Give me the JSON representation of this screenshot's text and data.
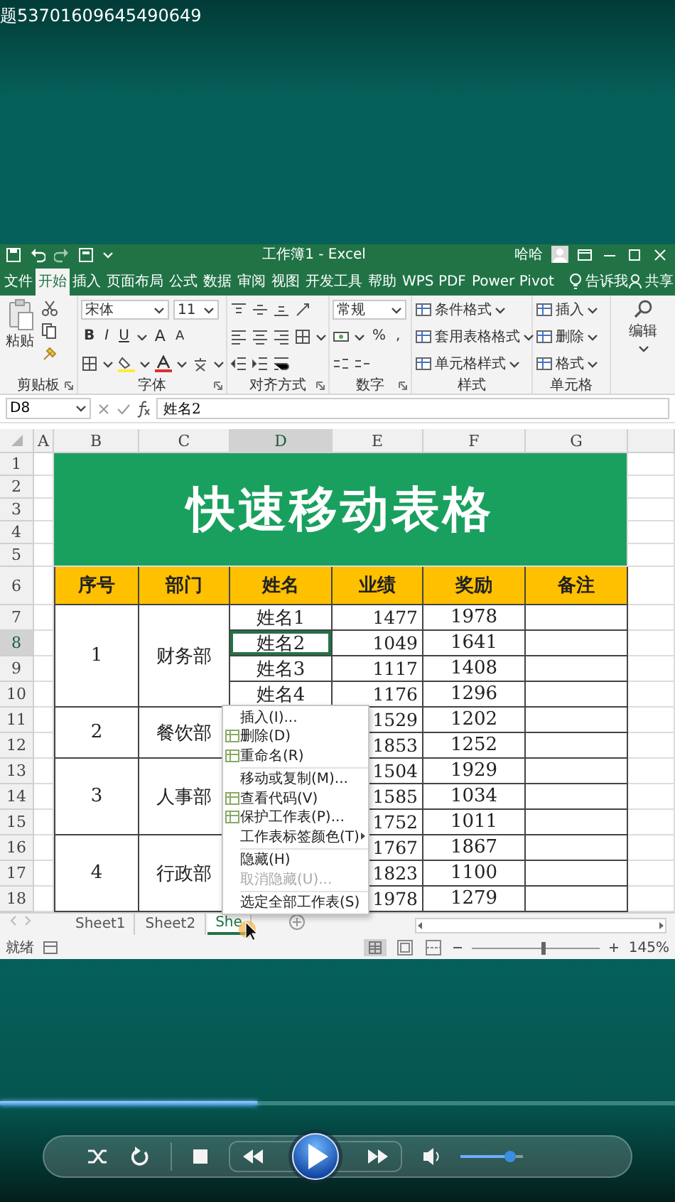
{
  "video_title": "题53701609645490649",
  "excel": {
    "window_title": "工作簿1 - Excel",
    "user": "哈哈",
    "ribbon_tabs": [
      {
        "label": "文件",
        "selected": false
      },
      {
        "label": "开始",
        "selected": true
      },
      {
        "label": "插入",
        "selected": false
      },
      {
        "label": "页面布局",
        "selected": false
      },
      {
        "label": "公式",
        "selected": false
      },
      {
        "label": "数据",
        "selected": false
      },
      {
        "label": "审阅",
        "selected": false
      },
      {
        "label": "视图",
        "selected": false
      },
      {
        "label": "开发工具",
        "selected": false
      },
      {
        "label": "帮助",
        "selected": false
      },
      {
        "label": "WPS PDF",
        "selected": false
      },
      {
        "label": "Power Pivot",
        "selected": false
      }
    ],
    "tell_me": "告诉我",
    "share": "共享",
    "ribbon": {
      "paste": "粘贴",
      "font_name": "宋体",
      "font_size": "11",
      "bold": "B",
      "italic": "I",
      "underline": "U",
      "grow_font": "A",
      "shrink_font": "A",
      "number_format": "常规",
      "percent": "%",
      "comma": ",",
      "styles": [
        "条件格式",
        "套用表格格式",
        "单元格样式"
      ],
      "cells": [
        "插入",
        "删除",
        "格式"
      ],
      "editing": "编辑",
      "groups": [
        "剪贴板",
        "字体",
        "对齐方式",
        "数字",
        "样式",
        "单元格"
      ]
    },
    "name_box": "D8",
    "formula": "姓名2",
    "columns": [
      {
        "label": "A",
        "selected": false
      },
      {
        "label": "B",
        "selected": false
      },
      {
        "label": "C",
        "selected": false
      },
      {
        "label": "D",
        "selected": true
      },
      {
        "label": "E",
        "selected": false
      },
      {
        "label": "F",
        "selected": false
      },
      {
        "label": "G",
        "selected": false
      }
    ],
    "rows": [
      {
        "label": "1",
        "selected": false
      },
      {
        "label": "2",
        "selected": false
      },
      {
        "label": "3",
        "selected": false
      },
      {
        "label": "4",
        "selected": false
      },
      {
        "label": "5",
        "selected": false
      },
      {
        "label": "6",
        "selected": false
      },
      {
        "label": "7",
        "selected": false
      },
      {
        "label": "8",
        "selected": true
      },
      {
        "label": "9",
        "selected": false
      },
      {
        "label": "10",
        "selected": false
      },
      {
        "label": "11",
        "selected": false
      },
      {
        "label": "12",
        "selected": false
      },
      {
        "label": "13",
        "selected": false
      },
      {
        "label": "14",
        "selected": false
      },
      {
        "label": "15",
        "selected": false
      },
      {
        "label": "16",
        "selected": false
      },
      {
        "label": "17",
        "selected": false
      },
      {
        "label": "18",
        "selected": false
      }
    ],
    "banner": "快速移动表格",
    "table": {
      "headers": [
        "序号",
        "部门",
        "姓名",
        "业绩",
        "奖励",
        "备注"
      ],
      "groups": [
        {
          "index": "1",
          "department": "财务部",
          "rows": [
            {
              "name": "姓名1",
              "performance": "1477",
              "bonus": "1978"
            },
            {
              "name": "姓名2",
              "performance": "1049",
              "bonus": "1641"
            },
            {
              "name": "姓名3",
              "performance": "1117",
              "bonus": "1408"
            },
            {
              "name": "姓名4",
              "performance": "1176",
              "bonus": "1296"
            }
          ]
        },
        {
          "index": "2",
          "department": "餐饮部",
          "rows": [
            {
              "performance": "1529",
              "bonus": "1202"
            },
            {
              "performance": "1853",
              "bonus": "1252"
            }
          ]
        },
        {
          "index": "3",
          "department": "人事部",
          "rows": [
            {
              "performance": "1504",
              "bonus": "1929"
            },
            {
              "performance": "1585",
              "bonus": "1034"
            },
            {
              "performance": "1752",
              "bonus": "1011"
            }
          ]
        },
        {
          "index": "4",
          "department": "行政部",
          "rows": [
            {
              "performance": "1767",
              "bonus": "1867"
            },
            {
              "performance": "1823",
              "bonus": "1100"
            },
            {
              "performance": "1978",
              "bonus": "1279"
            }
          ]
        }
      ]
    },
    "context_menu": [
      {
        "label": "插入(I)...",
        "icon": false,
        "disabled": false,
        "submenu": false
      },
      {
        "label": "删除(D)",
        "icon": true,
        "disabled": false,
        "submenu": false
      },
      {
        "label": "重命名(R)",
        "icon": true,
        "disabled": false,
        "submenu": false
      },
      {
        "label": "移动或复制(M)...",
        "icon": false,
        "disabled": false,
        "submenu": false
      },
      {
        "label": "查看代码(V)",
        "icon": true,
        "disabled": false,
        "submenu": false
      },
      {
        "label": "保护工作表(P)...",
        "icon": true,
        "disabled": false,
        "submenu": false
      },
      {
        "label": "工作表标签颜色(T)",
        "icon": false,
        "disabled": false,
        "submenu": true
      },
      {
        "label": "隐藏(H)",
        "icon": false,
        "disabled": false,
        "submenu": false
      },
      {
        "label": "取消隐藏(U)...",
        "icon": false,
        "disabled": true,
        "submenu": false
      },
      {
        "label": "选定全部工作表(S)",
        "icon": false,
        "disabled": false,
        "submenu": false
      }
    ],
    "sheet_tabs": [
      {
        "label": "Sheet1",
        "selected": false
      },
      {
        "label": "Sheet2",
        "selected": false
      },
      {
        "label": "She",
        "selected": true
      }
    ],
    "status": "就绪",
    "zoom": {
      "level": 0.55,
      "reading": "145%"
    }
  },
  "player": {
    "progress": {
      "level": 0.38
    },
    "volume": {
      "level": 0.8
    }
  }
}
